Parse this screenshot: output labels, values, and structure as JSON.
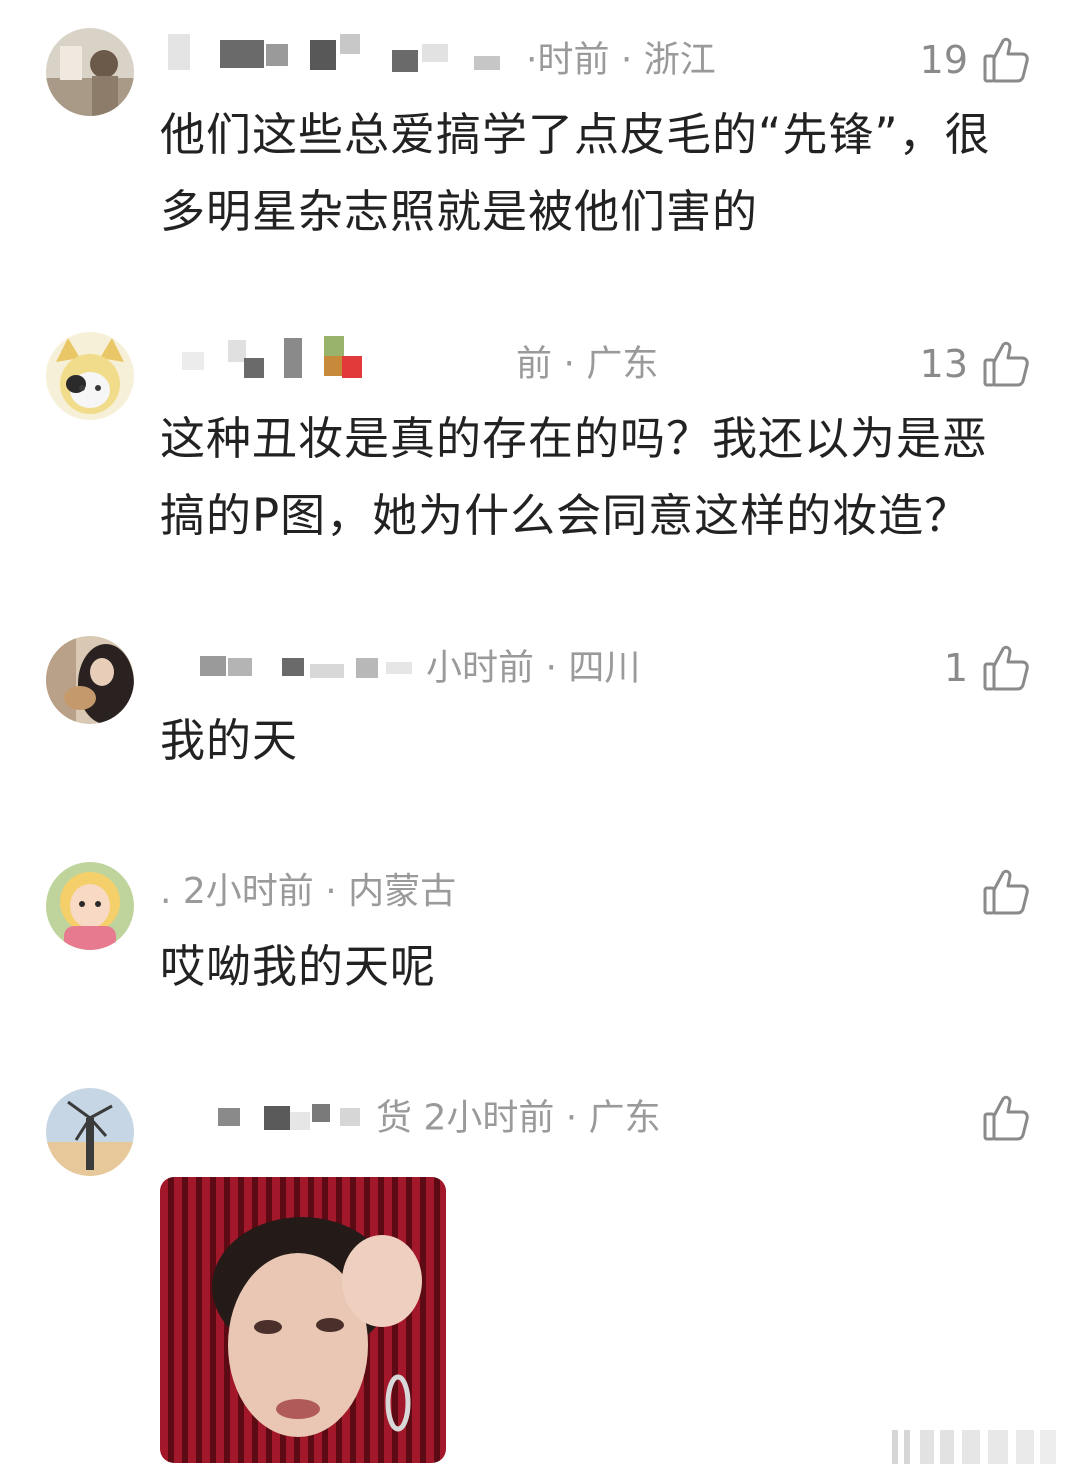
{
  "comments": [
    {
      "meta": "·时前 · 浙江",
      "likes": "19",
      "text": "他们这些总爱搞学了点皮毛的“先锋”，很多明星杂志照就是被他们害的"
    },
    {
      "meta": "前 · 广东",
      "likes": "13",
      "text": "这种丑妆是真的存在的吗？我还以为是恶搞的P图，她为什么会同意这样的妆造？"
    },
    {
      "meta": "小时前 · 四川",
      "likes": "1",
      "text": "我的天"
    },
    {
      "meta": ". 2小时前 · 内蒙古",
      "likes": "",
      "text": "哎呦我的天呢"
    },
    {
      "meta": "货 2小时前 · 广东",
      "likes": "",
      "text": ""
    }
  ],
  "colors": {
    "meta": "#9a9a9a",
    "text": "#222222",
    "icon": "#8a8a8a"
  },
  "icons": [
    "thumbs-up-icon"
  ]
}
